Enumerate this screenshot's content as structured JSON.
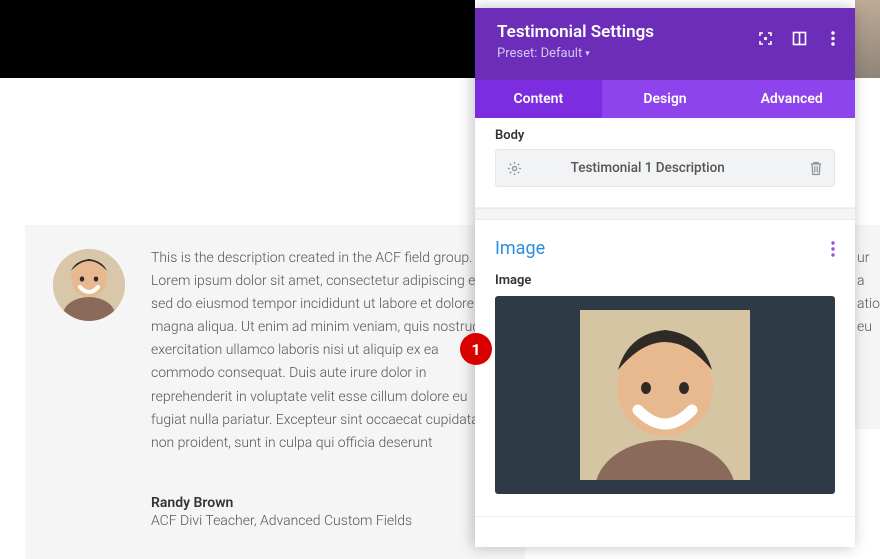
{
  "testimonial": {
    "description": "This is the description created in the ACF field group. Lorem ipsum dolor sit amet, consectetur adipiscing elit, sed do eiusmod tempor incididunt ut labore et dolore magna aliqua. Ut enim ad minim veniam, quis nostrud exercitation ullamco laboris nisi ut aliquip ex ea commodo consequat. Duis aute irure dolor in reprehenderit in voluptate velit esse cillum dolore eu fugiat nulla pariatur. Excepteur sint occaecat cupidatat non proident, sunt in culpa qui officia deserunt",
    "author": "Randy Brown",
    "author_role": "ACF Divi Teacher, Advanced Custom Fields"
  },
  "right_fragment": {
    "line1": "ur a",
    "line2": "atio",
    "line3": "eu"
  },
  "panel": {
    "title": "Testimonial Settings",
    "preset_label": "Preset: Default",
    "tabs": {
      "content": "Content",
      "design": "Design",
      "advanced": "Advanced"
    },
    "body_label": "Body",
    "body_dynamic_value": "Testimonial 1 Description",
    "image_section": "Image",
    "image_field_label": "Image"
  },
  "annotation": {
    "n1": "1"
  }
}
